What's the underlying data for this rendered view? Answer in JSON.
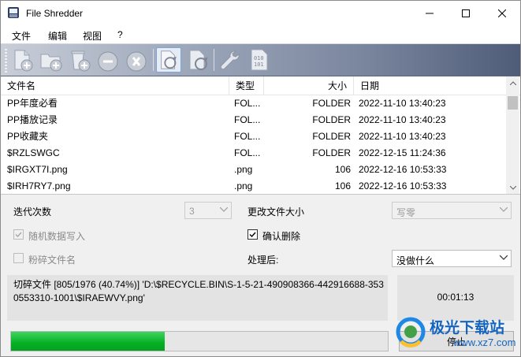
{
  "window": {
    "title": "File Shredder"
  },
  "menu": [
    "文件",
    "编辑",
    "视图",
    "?"
  ],
  "toolbar": {
    "buttons": [
      "add-file",
      "add-folder",
      "add-recycle-bin",
      "remove",
      "clear",
      "shred-refresh",
      "refresh",
      "settings",
      "binary"
    ]
  },
  "list": {
    "columns": [
      "文件名",
      "类型",
      "大小",
      "日期"
    ],
    "rows": [
      {
        "name": "PP年度必看",
        "type": "FOL...",
        "size": "FOLDER",
        "date": "2022-11-10 13:40:23"
      },
      {
        "name": "PP播放记录",
        "type": "FOL...",
        "size": "FOLDER",
        "date": "2022-11-10 13:40:23"
      },
      {
        "name": "PP收藏夹",
        "type": "FOL...",
        "size": "FOLDER",
        "date": "2022-11-10 13:40:23"
      },
      {
        "name": "$RZLSWGC",
        "type": "FOL...",
        "size": "FOLDER",
        "date": "2022-12-15 11:24:36"
      },
      {
        "name": "$IRGXT7I.png",
        "type": ".png",
        "size": "106",
        "date": "2022-12-16 10:53:33"
      },
      {
        "name": "$IRH7RY7.png",
        "type": ".png",
        "size": "106",
        "date": "2022-12-16 10:53:33"
      }
    ]
  },
  "options": {
    "iterations_label": "迭代次数",
    "iterations_value": "3",
    "change_size_label": "更改文件大小",
    "change_size_value": "写零",
    "random_write_label": "随机数据写入",
    "random_write_checked": true,
    "confirm_delete_label": "确认删除",
    "confirm_delete_checked": true,
    "shred_names_label": "粉碎文件名",
    "shred_names_checked": false,
    "after_label": "处理后:",
    "after_value": "没做什么"
  },
  "status": {
    "text": "切碎文件 [805/1976 (40.74%)] 'D:\\$RECYCLE.BIN\\S-1-5-21-490908366-442916688-3530553310-1001\\$IRAEWVY.png'",
    "elapsed": "00:01:13",
    "progress_fraction": 0.4074
  },
  "stop_label": "停止",
  "watermark": {
    "title": "极光下载站",
    "url": "www.xz7.com"
  },
  "colors": {
    "progress": "#06b025",
    "accent": "#1565c0"
  }
}
